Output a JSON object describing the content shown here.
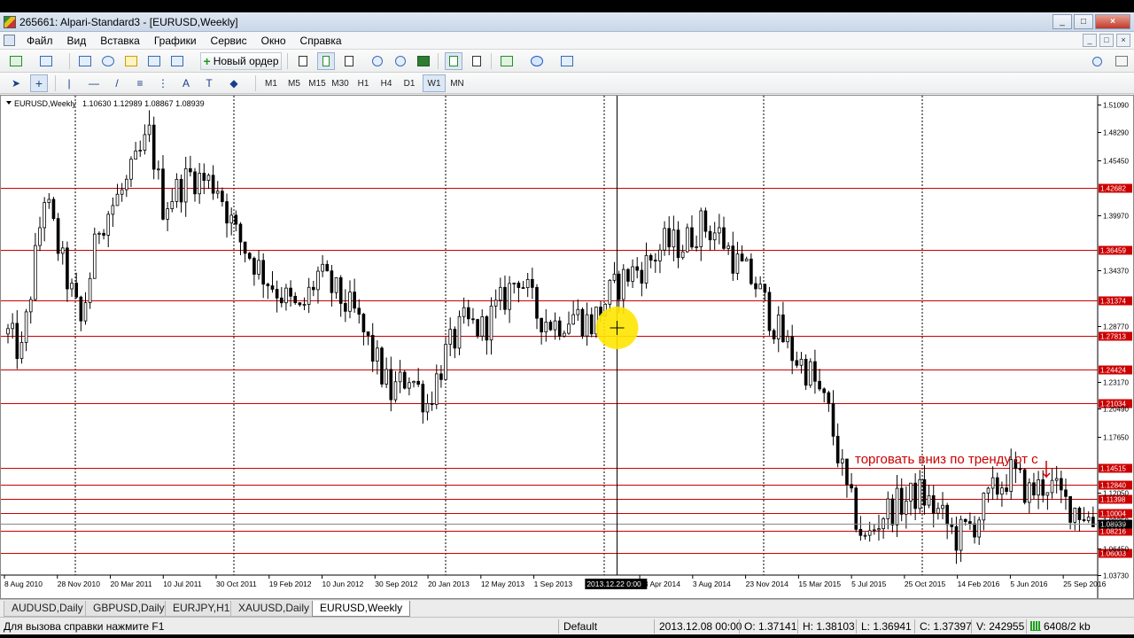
{
  "window": {
    "title": "265661: Alpari-Standard3 - [EURUSD,Weekly]",
    "buttons": [
      "_",
      "□",
      "×"
    ]
  },
  "menu": [
    "Файл",
    "Вид",
    "Вставка",
    "Графики",
    "Сервис",
    "Окно",
    "Справка"
  ],
  "toolbar": {
    "new_order_label": "Новый ордер"
  },
  "timeframes": [
    "M1",
    "M5",
    "M15",
    "M30",
    "H1",
    "H4",
    "D1",
    "W1",
    "MN"
  ],
  "active_timeframe": "W1",
  "chart": {
    "header": "EURUSD,Weekly",
    "ohlc": "1.10630 1.12989 1.08867 1.08939",
    "annotation": "торговать вниз по тренду от с",
    "accent_color": "#cc0000",
    "hover_date": "2013.12.22 0:00"
  },
  "chart_data": {
    "type": "candlestick",
    "symbol": "EURUSD",
    "timeframe": "Weekly",
    "ylim": [
      1.0373,
      1.5109
    ],
    "y_ticks": [
      1.5109,
      1.4829,
      1.4545,
      1.3997,
      1.3437,
      1.2878,
      1.2317,
      1.2049,
      1.1765,
      1.1205,
      1.0925,
      1.0645,
      1.0373
    ],
    "y_tick_labels": [
      "1.51090",
      "1.48290",
      "1.45450",
      "1.39970",
      "1.34370",
      "1.28770",
      "1.23170",
      "1.20490",
      "1.17650",
      "1.12050",
      "1.09250",
      "1.06450",
      "1.03730"
    ],
    "x_labels": [
      "8 Aug 2010",
      "28 Nov 2010",
      "20 Mar 2011",
      "10 Jul 2011",
      "30 Oct 2011",
      "19 Feb 2012",
      "10 Jun 2012",
      "30 Sep 2012",
      "20 Jan 2013",
      "12 May 2013",
      "1 Sep 2013",
      "2013.12.22 0:00",
      "13 Apr 2014",
      "3 Aug 2014",
      "23 Nov 2014",
      "15 Mar 2015",
      "5 Jul 2015",
      "25 Oct 2015",
      "14 Feb 2016",
      "5 Jun 2016",
      "25 Sep 2016"
    ],
    "levels": [
      1.42682,
      1.36459,
      1.31374,
      1.27813,
      1.24424,
      1.21034,
      1.14515,
      1.1284,
      1.11398,
      1.10004,
      1.08216,
      1.06003
    ],
    "level_labels": [
      "1.42682",
      "1.36459",
      "1.31374",
      "1.27813",
      "1.24424",
      "1.21034",
      "1.14515",
      "1.12840",
      "1.11398",
      "1.10004",
      "1.08216",
      "1.06003"
    ],
    "current_price": 1.08939,
    "current_price_label": "1.08939",
    "path": [
      [
        0,
        1.28
      ],
      [
        3,
        1.26
      ],
      [
        8,
        1.42
      ],
      [
        12,
        1.35
      ],
      [
        16,
        1.29
      ],
      [
        20,
        1.39
      ],
      [
        26,
        1.43
      ],
      [
        31,
        1.48
      ],
      [
        34,
        1.41
      ],
      [
        40,
        1.44
      ],
      [
        46,
        1.43
      ],
      [
        50,
        1.38
      ],
      [
        56,
        1.34
      ],
      [
        60,
        1.32
      ],
      [
        64,
        1.3
      ],
      [
        68,
        1.34
      ],
      [
        72,
        1.32
      ],
      [
        76,
        1.3
      ],
      [
        80,
        1.26
      ],
      [
        84,
        1.22
      ],
      [
        88,
        1.24
      ],
      [
        92,
        1.21
      ],
      [
        96,
        1.26
      ],
      [
        100,
        1.29
      ],
      [
        104,
        1.285
      ],
      [
        108,
        1.31
      ],
      [
        112,
        1.34
      ],
      [
        116,
        1.3
      ],
      [
        120,
        1.29
      ],
      [
        124,
        1.3
      ],
      [
        128,
        1.29
      ],
      [
        132,
        1.32
      ],
      [
        136,
        1.34
      ],
      [
        140,
        1.35
      ],
      [
        144,
        1.37
      ],
      [
        148,
        1.37
      ],
      [
        152,
        1.39
      ],
      [
        156,
        1.38
      ],
      [
        160,
        1.35
      ],
      [
        164,
        1.33
      ],
      [
        168,
        1.29
      ],
      [
        172,
        1.26
      ],
      [
        176,
        1.24
      ],
      [
        180,
        1.2
      ],
      [
        184,
        1.12
      ],
      [
        188,
        1.07
      ],
      [
        192,
        1.1
      ],
      [
        196,
        1.11
      ],
      [
        200,
        1.12
      ],
      [
        204,
        1.1
      ],
      [
        208,
        1.075
      ],
      [
        212,
        1.09
      ],
      [
        216,
        1.12
      ],
      [
        220,
        1.14
      ],
      [
        224,
        1.12
      ],
      [
        228,
        1.13
      ],
      [
        232,
        1.11
      ],
      [
        236,
        1.1
      ],
      [
        238,
        1.0894
      ]
    ]
  },
  "tabs": [
    "AUDUSD,Daily",
    "GBPUSD,Daily",
    "EURJPY,H1",
    "XAUUSD,Daily",
    "EURUSD,Weekly"
  ],
  "active_tab": "EURUSD,Weekly",
  "status": {
    "help": "Для вызова справки нажмите F1",
    "profile": "Default",
    "datetime": "2013.12.08 00:00",
    "open": "O: 1.37141",
    "high": "H: 1.38103",
    "low": "L: 1.36941",
    "close": "C: 1.37397",
    "volume": "V: 242955",
    "traffic": "6408/2 kb"
  }
}
